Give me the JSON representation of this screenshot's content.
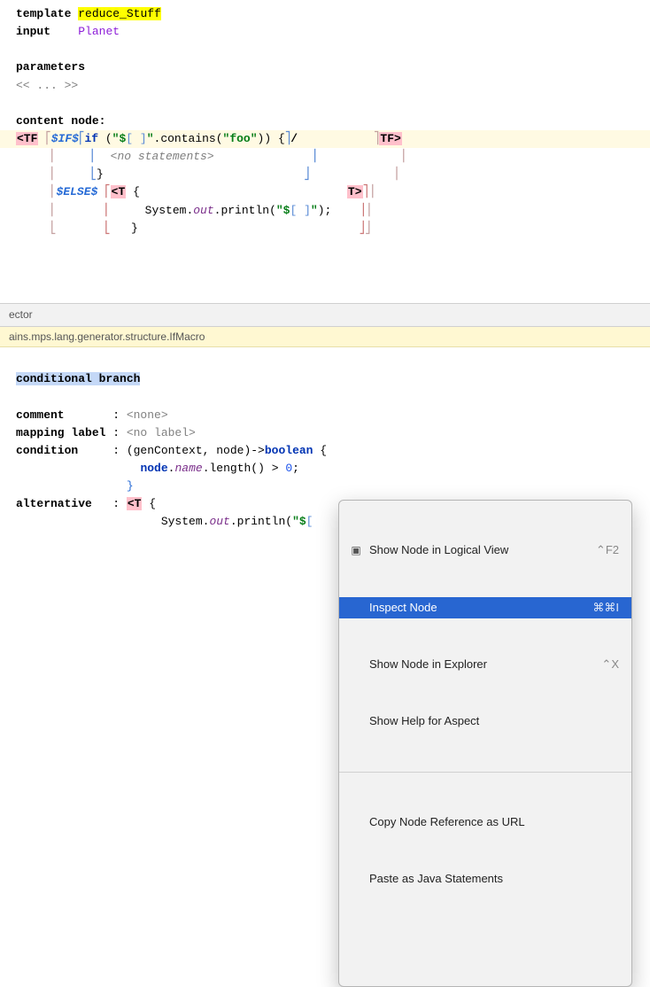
{
  "top": {
    "labels": {
      "template": "template",
      "input": "input",
      "parameters": "parameters",
      "content_node": "content node:"
    },
    "template_name": "reduce_Stuff",
    "input_type": "Planet",
    "fold": "<< ... >>",
    "macros": {
      "if": "$IF$",
      "else": "$ELSE$"
    },
    "tags": {
      "tf_open": "<TF",
      "tf_close": "TF>",
      "t_open": "<T",
      "t_close": "T>"
    },
    "code": {
      "if_kw": "if",
      "contains": ".contains(",
      "str_prefix": "\"$",
      "str_suffix": "\"",
      "foo": "\"foo\"",
      "close_brace": "}",
      "open_brace": "{",
      "no_stmt": "<no statements>",
      "println_pre": "System.",
      "println_out": "out",
      "println_post": ".println(",
      "println_end": ");",
      "slash": "/"
    }
  },
  "divider": {
    "ector": "ector"
  },
  "breadcrumb": "ains.mps.lang.generator.structure.IfMacro",
  "inspector": {
    "heading": "conditional branch",
    "rows": {
      "comment_k": "comment",
      "comment_v": "<none>",
      "mapping_k": "mapping label",
      "mapping_v": "<no label>",
      "condition_k": "condition",
      "alt_k": "alternative"
    },
    "condition": {
      "sig_open": "(genContext, node)->",
      "sig_ret": "boolean",
      "body_open": " {",
      "node": "node",
      "name": "name",
      "len": ".length() > ",
      "zero": "0",
      "semi": ";",
      "close": "}"
    },
    "alt": {
      "t_open": "<T",
      "open": " {",
      "println_pre": "System.",
      "println_out": "out",
      "println_post": ".println(",
      "str_prefix": "\"$"
    }
  },
  "menu": {
    "items": [
      {
        "label": "Show Node in Logical View",
        "shortcut": "⌃F2",
        "selected": false
      },
      {
        "label": "Inspect Node",
        "shortcut": "⌘⌘I",
        "selected": true
      },
      {
        "label": "Show Node in Explorer",
        "shortcut": "⌃X",
        "selected": false
      },
      {
        "label": "Show Help for Aspect",
        "shortcut": "",
        "selected": false
      }
    ],
    "items2": [
      {
        "label": "Copy Node Reference as URL",
        "shortcut": ""
      },
      {
        "label": "Paste as Java Statements",
        "shortcut": ""
      },
      {
        "label": "",
        "shortcut": ""
      }
    ]
  }
}
